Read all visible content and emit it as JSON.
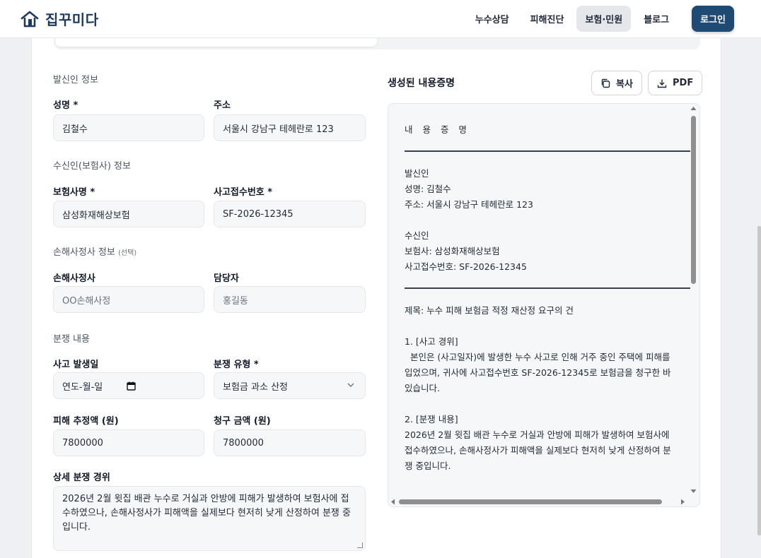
{
  "app": {
    "name": "집꾸미다"
  },
  "nav": {
    "items": [
      "누수상담",
      "피해진단",
      "보험·민원",
      "블로그"
    ],
    "active_index": 2,
    "login": "로그인"
  },
  "colors": {
    "brand": "#1e4a73",
    "field_bg": "#f6f7f9"
  },
  "sender": {
    "section_title": "발신인 정보",
    "name_label": "성명 *",
    "name_value": "김철수",
    "address_label": "주소",
    "address_value": "서울시 강남구 테헤란로 123"
  },
  "recipient": {
    "section_title": "수신인(보험사) 정보",
    "insurer_label": "보험사명 *",
    "insurer_value": "삼성화재해상보험",
    "claim_label": "사고접수번호 *",
    "claim_value": "SF-2026-12345"
  },
  "adjuster": {
    "section_title": "손해사정사 정보",
    "section_note": "(선택)",
    "company_label": "손해사정사",
    "company_placeholder": "OO손해사정",
    "person_label": "담당자",
    "person_placeholder": "홍길동"
  },
  "dispute": {
    "section_title": "분쟁 내용",
    "date_label": "사고 발생일",
    "date_placeholder": "연도-월-일",
    "type_label": "분쟁 유형 *",
    "type_value": "보험금 과소 산정",
    "damage_label": "피해 추정액 (원)",
    "damage_value": "7800000",
    "claim_amount_label": "청구 금액 (원)",
    "claim_amount_value": "7800000",
    "detail_label": "상세 분쟁 경위",
    "detail_value": "2026년 2월 윗집 배관 누수로 거실과 안방에 피해가 발생하여 보험사에 접수하였으나, 손해사정사가 피해액을 실제보다 현저히 낮게 산정하여 분쟁 중입니다."
  },
  "output": {
    "title": "생성된 내용증명",
    "copy_label": "복사",
    "pdf_label": "PDF",
    "doc_title": "내 용 증 명",
    "sender_heading": "발신인",
    "sender_name": "성명: 김철수",
    "sender_address": "주소: 서울시 강남구 테헤란로 123",
    "recipient_heading": "수신인",
    "recipient_insurer": "보험사: 삼성화재해상보험",
    "recipient_claim": "사고접수번호: SF-2026-12345",
    "subject": "제목: 누수 피해 보험금 적정 재산정 요구의 건",
    "s1_heading": "1. [사고 경위]",
    "s1_body": "  본인은 (사고일자)에 발생한 누수 사고로 인해 거주 중인 주택에 피해를 입었으며, 귀사에 사고접수번호 SF-2026-12345로 보험금을 청구한 바 있습니다.",
    "s2_heading": "2. [분쟁 내용]",
    "s2_body": "2026년 2월 윗집 배관 누수로 거실과 안방에 피해가 발생하여 보험사에 접수하였으나, 손해사정사가 피해액을 실제보다 현저히 낮게 산정하여 분쟁 중입니다."
  }
}
